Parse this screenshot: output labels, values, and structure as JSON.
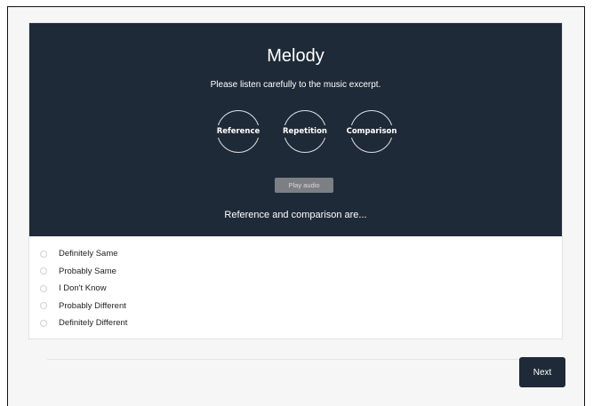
{
  "page": {
    "title": "Melody",
    "subtitle": "Please listen carefully to the music excerpt.",
    "stages": [
      "Reference",
      "Repetition",
      "Comparison"
    ],
    "play_label": "Play audio",
    "question": "Reference and comparison are...",
    "options": [
      "Definitely Same",
      "Probably Same",
      "I Don't Know",
      "Probably Different",
      "Definitely Different"
    ],
    "next_label": "Next"
  },
  "colors": {
    "hero_bg": "#1f2a38",
    "button_bg": "#1f2a38",
    "play_bg": "#7c7f84"
  }
}
